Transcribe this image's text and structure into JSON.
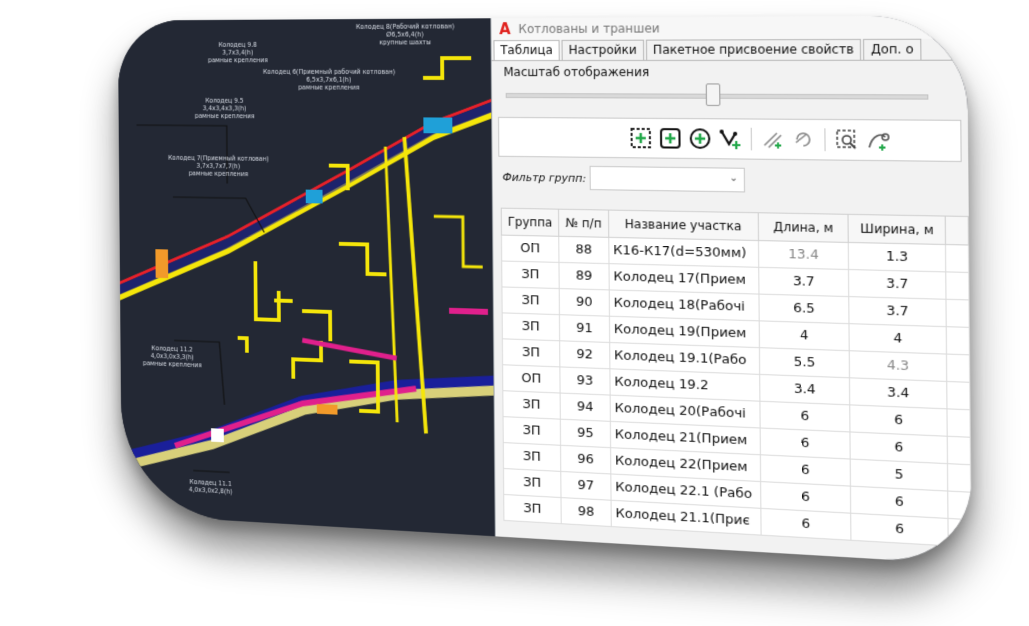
{
  "window": {
    "title": "Котлованы и траншеи",
    "logo": "A"
  },
  "tabs": [
    {
      "label": "Таблица",
      "active": true
    },
    {
      "label": "Настройки",
      "active": false
    },
    {
      "label": "Пакетное присвоение свойств",
      "active": false
    },
    {
      "label": "Доп. о",
      "active": false
    }
  ],
  "scale": {
    "label": "Масштаб отображения",
    "value": 0.5
  },
  "toolbar": {
    "icons": [
      "select-area-add-icon",
      "add-square-icon",
      "add-circle-icon",
      "route-add-icon",
      "draw-line-add-icon",
      "rotate-icon",
      "zoom-frame-icon",
      "curve-add-icon"
    ]
  },
  "filter": {
    "label": "Фильтр групп:",
    "value": ""
  },
  "table": {
    "headers": [
      "Группа",
      "№ п/п",
      "Название участка",
      "Длина, м",
      "Ширина, м"
    ],
    "rows": [
      {
        "group": "ОП",
        "no": "88",
        "name": "К16-К17(d=530мм)",
        "length": "13.4",
        "width": "1.3",
        "len_dim": true,
        "wid_dim": false
      },
      {
        "group": "ЗП",
        "no": "89",
        "name": "Колодец 17(Прием",
        "length": "3.7",
        "width": "3.7",
        "len_dim": false,
        "wid_dim": false
      },
      {
        "group": "ЗП",
        "no": "90",
        "name": "Колодец 18(Рабочі",
        "length": "6.5",
        "width": "3.7",
        "len_dim": false,
        "wid_dim": false
      },
      {
        "group": "ЗП",
        "no": "91",
        "name": "Колодец 19(Прием",
        "length": "4",
        "width": "4",
        "len_dim": false,
        "wid_dim": false
      },
      {
        "group": "ЗП",
        "no": "92",
        "name": "Колодец 19.1(Рабо",
        "length": "5.5",
        "width": "4.3",
        "len_dim": false,
        "wid_dim": true
      },
      {
        "group": "ОП",
        "no": "93",
        "name": "Колодец 19.2",
        "length": "3.4",
        "width": "3.4",
        "len_dim": false,
        "wid_dim": false
      },
      {
        "group": "ЗП",
        "no": "94",
        "name": "Колодец 20(Рабочі",
        "length": "6",
        "width": "6",
        "len_dim": false,
        "wid_dim": false
      },
      {
        "group": "ЗП",
        "no": "95",
        "name": "Колодец 21(Прием",
        "length": "6",
        "width": "6",
        "len_dim": false,
        "wid_dim": false
      },
      {
        "group": "ЗП",
        "no": "96",
        "name": "Колодец 22(Прием",
        "length": "6",
        "width": "5",
        "len_dim": false,
        "wid_dim": false
      },
      {
        "group": "ЗП",
        "no": "97",
        "name": "Колодец 22.1 (Рабо",
        "length": "6",
        "width": "6",
        "len_dim": false,
        "wid_dim": false
      },
      {
        "group": "ЗП",
        "no": "98",
        "name": "Колодец 21.1(Приє",
        "length": "6",
        "width": "6",
        "len_dim": false,
        "wid_dim": false
      }
    ]
  },
  "cad_labels": [
    {
      "id": "l1",
      "text": "Колодец 8(Рабочий котлован)"
    },
    {
      "id": "l2",
      "text": "Ø6,5х6,4(h)"
    },
    {
      "id": "l3",
      "text": "крупные шахты"
    },
    {
      "id": "l4",
      "text": "Колодец 6(Приемный рабочий котлован)"
    },
    {
      "id": "l5",
      "text": "6,5х3,7х6,1(h)"
    },
    {
      "id": "l6",
      "text": "рамные крепления"
    },
    {
      "id": "l7",
      "text": "Колодец 9.5"
    },
    {
      "id": "l8",
      "text": "3,4х3,4х3,3(h)"
    },
    {
      "id": "l9",
      "text": "рамные крепления"
    },
    {
      "id": "l10",
      "text": "Колодец 7(Приемный котлован)"
    },
    {
      "id": "l11",
      "text": "3,7х3,7х7,7(h)"
    },
    {
      "id": "l12",
      "text": "рамные крепления"
    },
    {
      "id": "l13",
      "text": "Колодец 11.2"
    },
    {
      "id": "l14",
      "text": "4,0х3,0х3,3(h)"
    },
    {
      "id": "l15",
      "text": "рамные крепления"
    },
    {
      "id": "l16",
      "text": "Колодец 11.1"
    },
    {
      "id": "l17",
      "text": "4,0х3,0х2,8(h)"
    },
    {
      "id": "l18",
      "text": "Колодец 9.8"
    },
    {
      "id": "l19",
      "text": "3,7х3,4(h)"
    },
    {
      "id": "l20",
      "text": "рамные крепления"
    }
  ],
  "colors": {
    "cad_background": "#232834",
    "pipe_yellow": "#f5e60a",
    "pipe_red": "#e8202a",
    "pipe_blue": "#1a1f9a",
    "pipe_magenta": "#e0208c",
    "accent_green": "#22a84a",
    "logo_red": "#e0201c"
  }
}
